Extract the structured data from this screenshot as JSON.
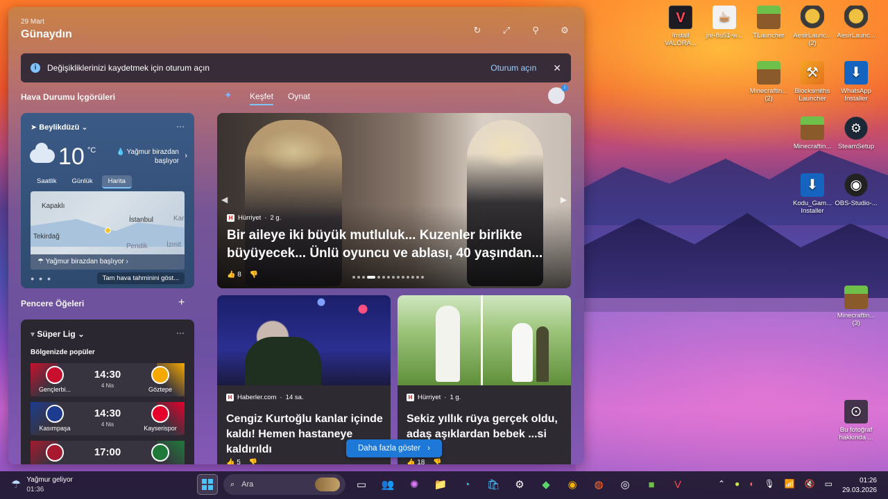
{
  "panel": {
    "date": "29 Mart",
    "greeting": "Günaydın",
    "signin_banner": {
      "text": "Değişikliklerinizi kaydetmek için oturum açın",
      "button": "Oturum açın"
    },
    "section_weather": "Hava Durumu İçgörüleri",
    "section_widgets": "Pencere Öğeleri"
  },
  "weather": {
    "location": "Beylikdüzü",
    "temperature": "10",
    "unit": "°C",
    "description": "Yağmur birazdan başlıyor",
    "tabs": [
      "Saatlik",
      "Günlük",
      "Harita"
    ],
    "active_tab": "Harita",
    "map_labels": {
      "kapakli": "Kapaklı",
      "istanbul": "İstanbul",
      "tekirdag": "Tekirdağ",
      "pendik": "Pendik",
      "izmit": "İzmit",
      "kar": "Kar"
    },
    "map_banner": "Yağmur birazdan başlıyor",
    "full_forecast": "Tam hava tahminini göst..."
  },
  "sports": {
    "title": "Süper Lig",
    "subtitle": "Bölgenizde popüler",
    "matches": [
      {
        "home": "Gençlerbi...",
        "away": "Göztepe",
        "time": "14:30",
        "date": "4 Nis",
        "home_color": "#c8102e",
        "away_color": "#f5a800"
      },
      {
        "home": "Kasımpaşa",
        "away": "Kayserispor",
        "time": "14:30",
        "date": "4 Nis",
        "home_color": "#1d3c8f",
        "away_color": "#e4002b"
      },
      {
        "home": "",
        "away": "",
        "time": "17:00",
        "date": "",
        "home_color": "#a6192e",
        "away_color": "#1f7a3a"
      }
    ]
  },
  "feed": {
    "tabs": [
      "Keşfet",
      "Oynat"
    ],
    "active_tab": "Keşfet",
    "hero": {
      "source": "Hürriyet",
      "age": "2 g.",
      "title": "Bir aileye iki büyük mutluluk... Kuzenler birlikte büyüyecek... Ünlü oyuncu ve ablası, 40 yaşından...",
      "likes": "8"
    },
    "cards": [
      {
        "source": "Haberler.com",
        "age": "14 sa.",
        "title": "Cengiz Kurtoğlu kanlar içinde kaldı! Hemen hastaneye kaldırıldı",
        "likes": "5"
      },
      {
        "source": "Hürriyet",
        "age": "1 g.",
        "title": "Sekiz yıllık rüya gerçek oldu, adaş aşıklardan bebek ...si geldi!",
        "likes": "18"
      }
    ],
    "more_button": "Daha fazla göster"
  },
  "desktop_icons": [
    {
      "label": "Install VALORA...",
      "icon": "valorant-icon"
    },
    {
      "label": "jre-8u51-w...",
      "icon": "java-icon"
    },
    {
      "label": "TLauncher",
      "icon": "minecraft-grass-icon"
    },
    {
      "label": "AesirLaunc... (2)",
      "icon": "aesir-icon"
    },
    {
      "label": "AesirLaunc...",
      "icon": "aesir-icon"
    },
    {
      "label": "Minecraftin... (2)",
      "icon": "minecraft-grass-icon"
    },
    {
      "label": "Blocksmiths Launcher",
      "icon": "hammer-icon"
    },
    {
      "label": "WhatsApp Installer",
      "icon": "download-icon"
    },
    {
      "label": "Minecraftin...",
      "icon": "minecraft-grass-icon"
    },
    {
      "label": "SteamSetup",
      "icon": "steam-icon"
    },
    {
      "label": "Kodu_Gam... Installer",
      "icon": "download-icon"
    },
    {
      "label": "OBS-Studio-...",
      "icon": "obs-icon"
    },
    {
      "label": "Minecraftin... (3)",
      "icon": "minecraft-grass-icon"
    },
    {
      "label": "Bu fotoğraf hakkında ...",
      "icon": "photo-info-icon"
    }
  ],
  "taskbar": {
    "weather_title": "Yağmur geliyor",
    "weather_time": "01:36",
    "search_placeholder": "Ara",
    "clock_time": "01:26",
    "clock_date": "29.03.2026"
  }
}
